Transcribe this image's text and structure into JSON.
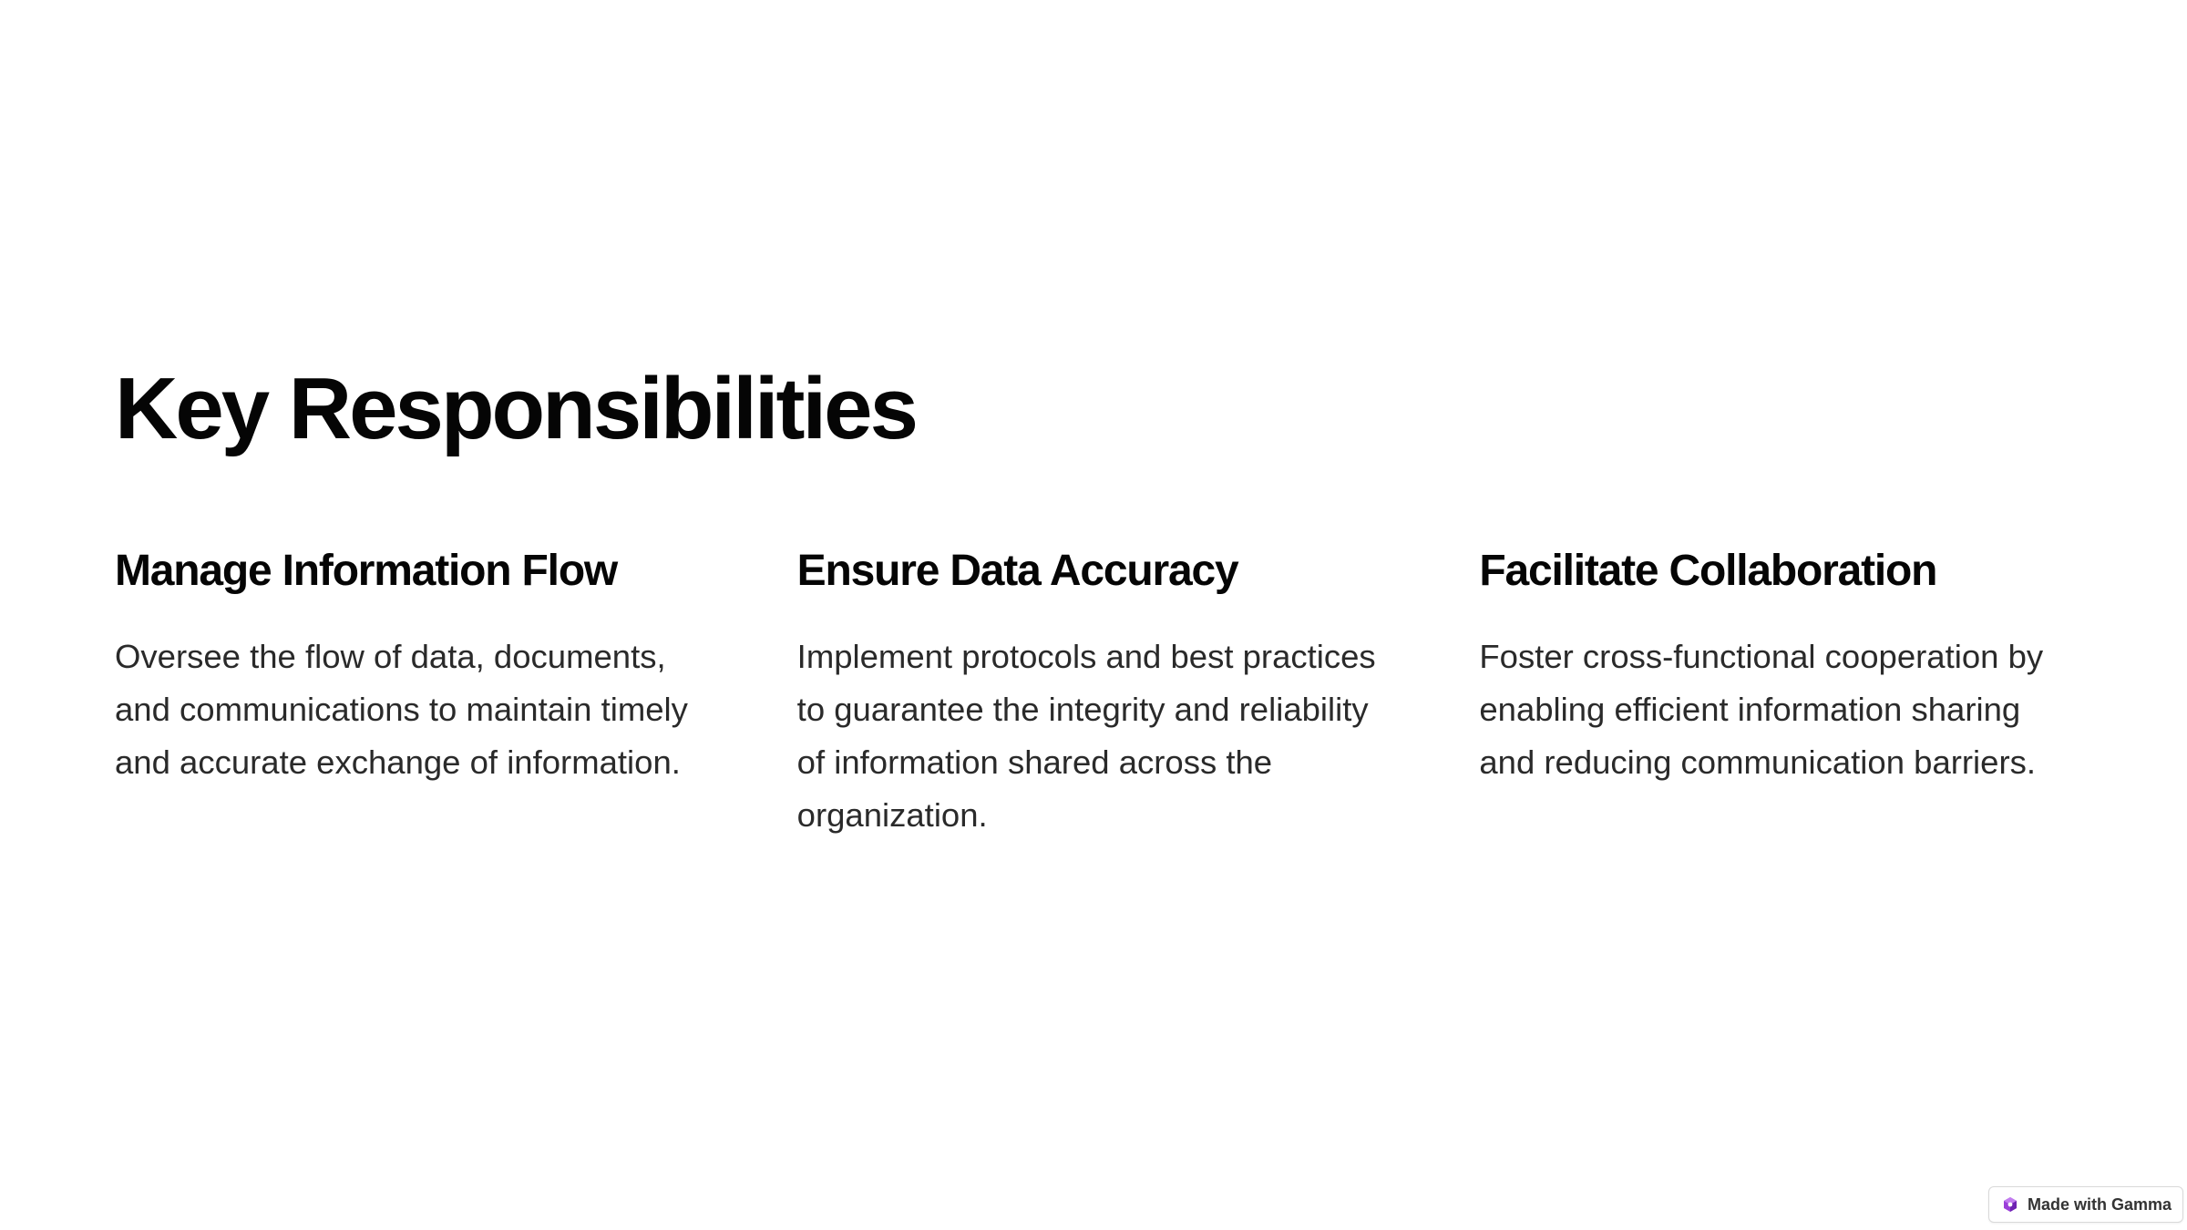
{
  "slide": {
    "title": "Key Responsibilities",
    "columns": [
      {
        "heading": "Manage Information Flow",
        "body": "Oversee the flow of data, documents, and communications to maintain timely and accurate exchange of information."
      },
      {
        "heading": "Ensure Data Accuracy",
        "body": "Implement protocols and best practices to guarantee the integrity and reliability of information shared across the organization."
      },
      {
        "heading": "Facilitate Collaboration",
        "body": "Foster cross-functional cooperation by enabling efficient information sharing and reducing communication barriers."
      }
    ]
  },
  "badge": {
    "label": "Made with Gamma",
    "icon": "gamma-logo-icon",
    "icon_color": "#9b3fd9"
  }
}
